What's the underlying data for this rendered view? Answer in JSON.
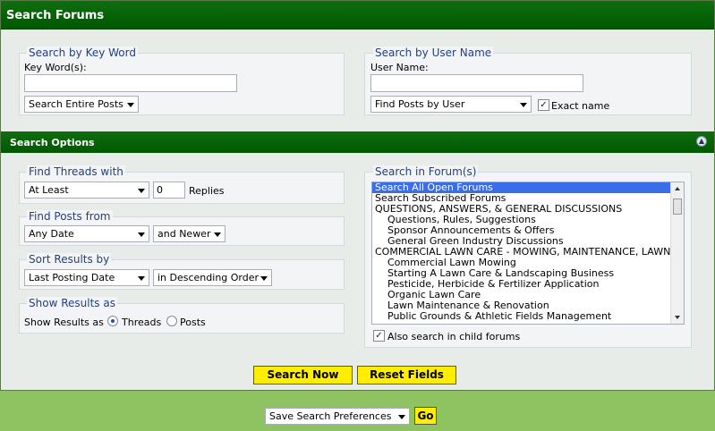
{
  "header": {
    "title": "Search Forums"
  },
  "keyword": {
    "legend": "Search by Key Word",
    "label": "Key Word(s):",
    "value": "",
    "scope_select": "Search Entire Posts"
  },
  "user": {
    "legend": "Search by User Name",
    "label": "User Name:",
    "value": "",
    "mode_select": "Find Posts by User",
    "exact_label": "Exact name",
    "exact_checked": true
  },
  "options_header": {
    "title": "Search Options",
    "collapse_icon": "collapse-up-icon"
  },
  "threads": {
    "legend": "Find Threads with",
    "qualifier_select": "At Least",
    "replies_value": "0",
    "replies_label": "Replies"
  },
  "posts_from": {
    "legend": "Find Posts from",
    "date_select": "Any Date",
    "direction_select": "and Newer"
  },
  "sort": {
    "legend": "Sort Results by",
    "field_select": "Last Posting Date",
    "order_select": "in Descending Order"
  },
  "show": {
    "legend": "Show Results as",
    "label": "Show Results as",
    "threads_label": "Threads",
    "posts_label": "Posts",
    "selected": "Threads"
  },
  "forums": {
    "legend": "Search in Forum(s)",
    "items": [
      {
        "label": "Search All Open Forums",
        "level": 0,
        "selected": true
      },
      {
        "label": "Search Subscribed Forums",
        "level": 0
      },
      {
        "label": "QUESTIONS, ANSWERS, & GENERAL DISCUSSIONS",
        "level": 0
      },
      {
        "label": "Questions, Rules, Suggestions",
        "level": 1
      },
      {
        "label": "Sponsor Announcements & Offers",
        "level": 1
      },
      {
        "label": "General Green Industry Discussions",
        "level": 1
      },
      {
        "label": "COMMERCIAL LAWN CARE - MOWING, MAINTENANCE, LAWN",
        "level": 0
      },
      {
        "label": "Commercial Lawn Mowing",
        "level": 1
      },
      {
        "label": "Starting A Lawn Care & Landscaping Business",
        "level": 1
      },
      {
        "label": "Pesticide, Herbicide & Fertilizer Application",
        "level": 1
      },
      {
        "label": "Organic Lawn Care",
        "level": 1
      },
      {
        "label": "Lawn Maintenance & Renovation",
        "level": 1
      },
      {
        "label": "Public Grounds & Athletic Fields Management",
        "level": 1
      }
    ],
    "child_label": "Also search in child forums",
    "child_checked": true
  },
  "actions": {
    "search_now": "Search Now",
    "reset": "Reset Fields"
  },
  "footer": {
    "prefs_select": "Save Search Preferences",
    "go": "Go"
  }
}
